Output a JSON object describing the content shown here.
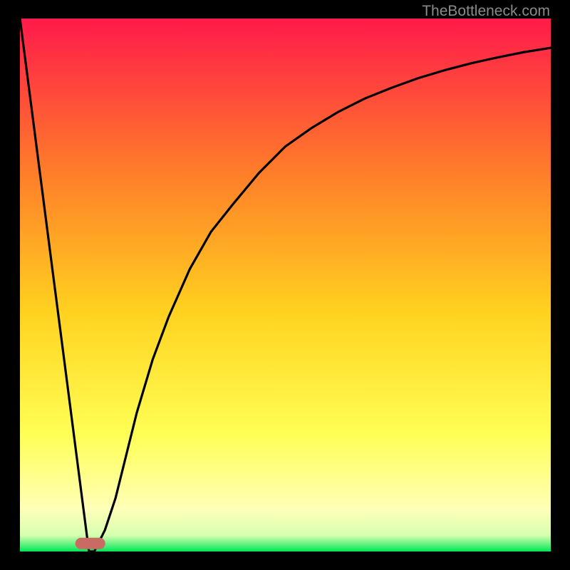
{
  "watermark": "TheBottleneck.com",
  "colors": {
    "frame": "#000000",
    "gradient_top": "#ff1a4b",
    "gradient_mid1": "#ff7a2a",
    "gradient_mid2": "#ffd21f",
    "gradient_low": "#ffff55",
    "gradient_pale": "#ffffb8",
    "gradient_bottom": "#00e756",
    "curve": "#000000",
    "marker": "#c96a63"
  },
  "chart_data": {
    "type": "line",
    "title": "",
    "xlabel": "",
    "ylabel": "",
    "xlim": [
      0,
      100
    ],
    "ylim": [
      0,
      100
    ],
    "x": [
      0,
      2,
      4,
      6,
      8,
      10,
      11,
      12,
      13,
      14,
      15,
      16,
      18,
      20,
      22,
      25,
      28,
      32,
      36,
      40,
      45,
      50,
      55,
      60,
      65,
      70,
      75,
      80,
      85,
      90,
      95,
      100
    ],
    "y": [
      100,
      84.6,
      69.2,
      53.8,
      38.5,
      23.1,
      15.4,
      7.7,
      0,
      0,
      2,
      4,
      10,
      18,
      26,
      36,
      44,
      53,
      60,
      65,
      71,
      76,
      79.5,
      82.5,
      85,
      87,
      88.8,
      90.3,
      91.6,
      92.7,
      93.7,
      94.5
    ],
    "marker": {
      "x_start": 11.5,
      "x_end": 15,
      "y": 1.5
    },
    "annotations": []
  }
}
